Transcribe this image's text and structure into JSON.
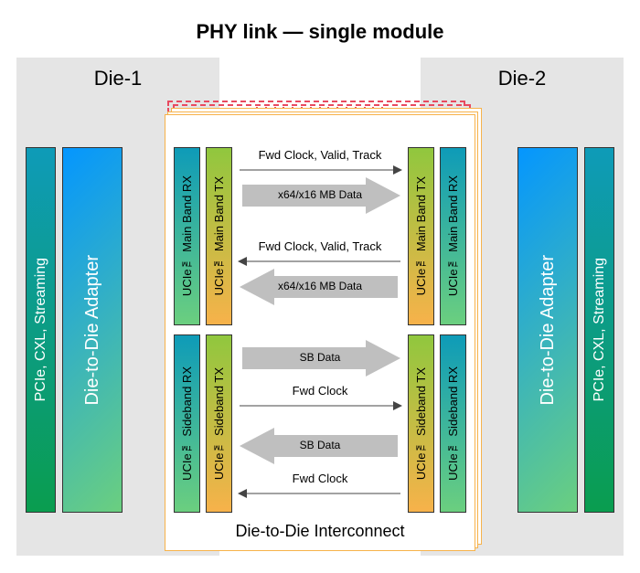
{
  "title": "PHY link — single module",
  "die1_label": "Die-1",
  "die2_label": "Die-2",
  "d2d_label": "Die-to-Die Interconnect",
  "bars": {
    "pcie": "PCIe, CXL, Streaming",
    "adapter": "Die-to-Die Adapter",
    "mb_rx": "UCIe™ Main Band RX",
    "mb_tx": "UCIe™ Main Band TX",
    "sb_rx": "UCIe™ Sideband RX",
    "sb_tx": "UCIe™ Sideband TX"
  },
  "signals": {
    "fwd_clock_valid_track": "Fwd Clock, Valid, Track",
    "mb_data": "x64/x16 MB Data",
    "sb_data": "SB Data",
    "fwd_clock": "Fwd Clock"
  }
}
